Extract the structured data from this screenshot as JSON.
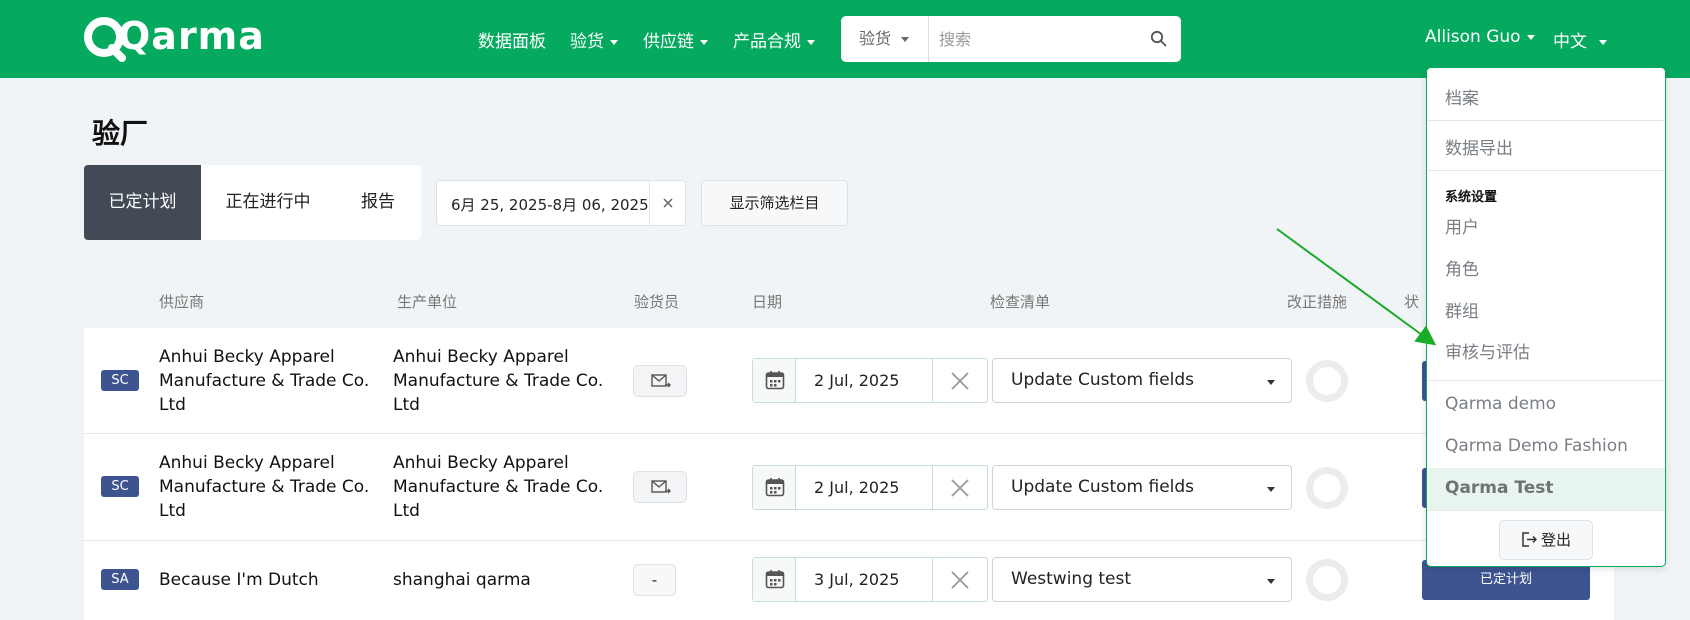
{
  "header": {
    "logo_text": "Qarma",
    "nav": [
      {
        "label": "数据面板",
        "dropdown": false
      },
      {
        "label": "验货",
        "dropdown": true
      },
      {
        "label": "供应链",
        "dropdown": true
      },
      {
        "label": "产品合规",
        "dropdown": true
      }
    ],
    "search_type": "验货",
    "search_placeholder": "搜索",
    "user_name": "Allison Guo",
    "language": "中文"
  },
  "page": {
    "title": "验厂",
    "tabs": [
      "已定计划",
      "正在进行中",
      "报告"
    ],
    "active_tab": 0,
    "date_range": "6月 25, 2025-8月 06, 2025",
    "filter_button": "显示筛选栏目"
  },
  "table": {
    "columns": [
      "供应商",
      "生产单位",
      "验货员",
      "日期",
      "检查清单",
      "改正措施",
      "状"
    ],
    "rows": [
      {
        "badge": "SC",
        "supplier": "Anhui Becky Apparel Manufacture & Trade Co. Ltd",
        "unit": "Anhui Becky Apparel Manufacture & Trade Co. Ltd",
        "inspector": "",
        "date": "2 Jul, 2025",
        "checklist": "Update Custom fields",
        "status": ""
      },
      {
        "badge": "SC",
        "supplier": "Anhui Becky Apparel Manufacture & Trade Co. Ltd",
        "unit": "Anhui Becky Apparel Manufacture & Trade Co. Ltd",
        "inspector": "",
        "date": "2 Jul, 2025",
        "checklist": "Update Custom fields",
        "status": ""
      },
      {
        "badge": "SA",
        "supplier": "Because I'm Dutch",
        "unit": "shanghai qarma",
        "inspector": "-",
        "date": "3 Jul, 2025",
        "checklist": "Westwing test",
        "status": "已定计划"
      }
    ]
  },
  "dropdown": {
    "items_top": [
      "档案",
      "数据导出"
    ],
    "section_heading": "系统设置",
    "settings": [
      "用户",
      "角色",
      "群组",
      "审核与评估"
    ],
    "companies": [
      "Qarma demo",
      "Qarma Demo Fashion",
      "Qarma Test"
    ],
    "active_company": "Qarma Test",
    "logout": "登出"
  },
  "colors": {
    "brand_green": "#06aa5f",
    "active_tab": "#424a55",
    "badge_blue": "#3d5491",
    "arrow_green": "#1aab29"
  }
}
